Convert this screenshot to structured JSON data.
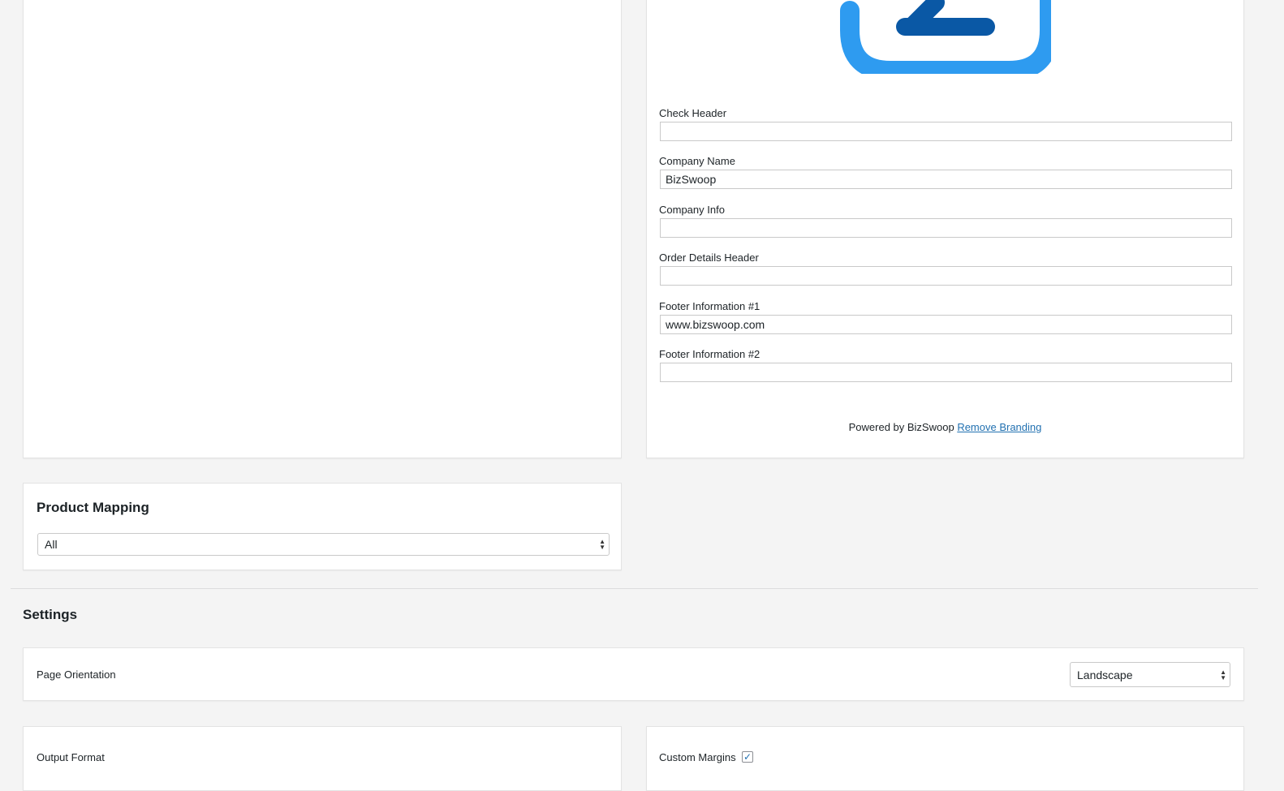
{
  "branding_panel": {
    "fields": [
      {
        "label": "Check Header",
        "value": ""
      },
      {
        "label": "Company Name",
        "value": "BizSwoop"
      },
      {
        "label": "Company Info",
        "value": ""
      },
      {
        "label": "Order Details Header",
        "value": ""
      },
      {
        "label": "Footer Information #1",
        "value": "www.bizswoop.com"
      },
      {
        "label": "Footer Information #2",
        "value": ""
      }
    ],
    "powered_by": "Powered by BizSwoop",
    "remove_branding_link": "Remove Branding",
    "logo_colors": {
      "outer": "#2e9bf0",
      "inner": "#0a58a5"
    }
  },
  "product_mapping": {
    "title": "Product Mapping",
    "selected": "All"
  },
  "settings": {
    "title": "Settings",
    "page_orientation_label": "Page Orientation",
    "page_orientation_value": "Landscape",
    "output_format_label": "Output Format",
    "custom_margins_label": "Custom Margins",
    "custom_margins_checked": true
  },
  "colors": {
    "accent": "#2271b1",
    "background": "#f4f4f4"
  }
}
